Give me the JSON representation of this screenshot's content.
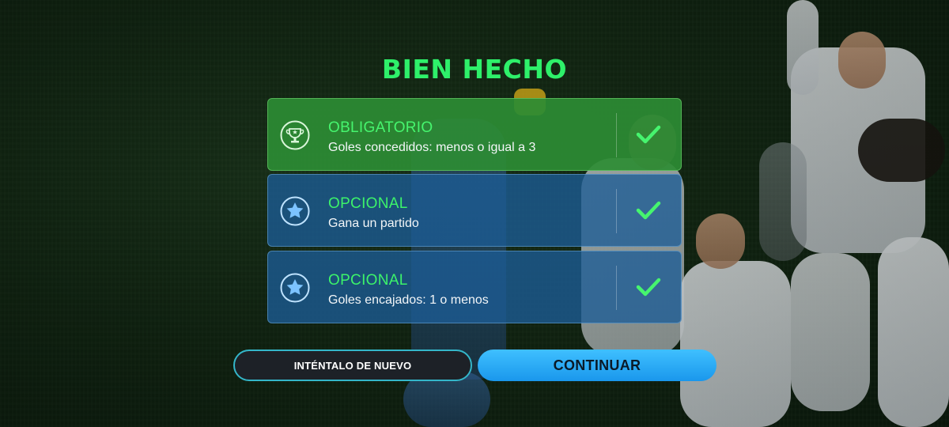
{
  "title": "BIEN HECHO",
  "objectives": [
    {
      "kind": "OBLIGATORIO",
      "description": "Goles concedidos: menos o igual a 3",
      "icon": "trophy-icon",
      "completed": true
    },
    {
      "kind": "OPCIONAL",
      "description": "Gana un partido",
      "icon": "star-icon",
      "completed": true
    },
    {
      "kind": "OPCIONAL",
      "description": "Goles encajados: 1 o menos",
      "icon": "star-icon",
      "completed": true
    }
  ],
  "buttons": {
    "retry_label": "INTÉNTALO DE NUEVO",
    "continue_label": "CONTINUAR"
  },
  "colors": {
    "title": "#2ef06a",
    "mandatory_card": "#2c8c34",
    "optional_card": "#1c5c96",
    "check": "#3cf36a",
    "continue_button": "#1a97ec",
    "retry_border": "#34b6c9"
  }
}
